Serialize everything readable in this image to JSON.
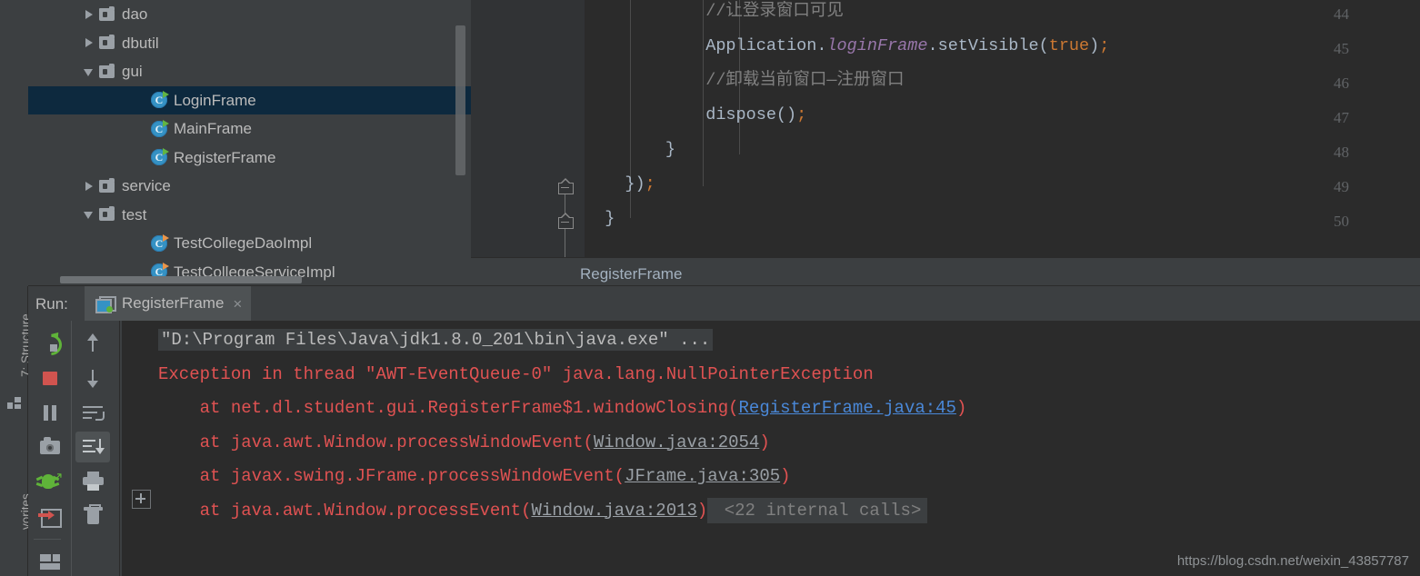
{
  "tool_strip": {
    "structure_tab": "7: Structure",
    "favorites_tab": "vorites"
  },
  "project_tree": {
    "items": [
      {
        "label": "dao",
        "kind": "folder",
        "arrow": "right",
        "indent": 60,
        "selected": false
      },
      {
        "label": "dbutil",
        "kind": "folder",
        "arrow": "right",
        "indent": 60,
        "selected": false
      },
      {
        "label": "gui",
        "kind": "folder",
        "arrow": "down",
        "indent": 60,
        "selected": false
      },
      {
        "label": "LoginFrame",
        "kind": "class",
        "arrow": "none",
        "indent": 135,
        "selected": true
      },
      {
        "label": "MainFrame",
        "kind": "class",
        "arrow": "none",
        "indent": 135,
        "selected": false
      },
      {
        "label": "RegisterFrame",
        "kind": "class",
        "arrow": "none",
        "indent": 135,
        "selected": false
      },
      {
        "label": "service",
        "kind": "folder",
        "arrow": "right",
        "indent": 60,
        "selected": false
      },
      {
        "label": "test",
        "kind": "folder",
        "arrow": "down",
        "indent": 60,
        "selected": false
      },
      {
        "label": "TestCollegeDaoImpl",
        "kind": "test-class",
        "arrow": "none",
        "indent": 135,
        "selected": false
      },
      {
        "label": "TestCollegeServiceImpl",
        "kind": "test-class",
        "arrow": "none",
        "indent": 135,
        "selected": false
      }
    ]
  },
  "editor": {
    "line_numbers": [
      "44",
      "45",
      "46",
      "47",
      "48",
      "49",
      "50"
    ],
    "lines": [
      {
        "num": "44",
        "segments": [
          {
            "text": "            //让登录窗口可见",
            "cls": "tok-cmt"
          }
        ]
      },
      {
        "num": "45",
        "segments": [
          {
            "text": "            Application",
            "cls": "tok-plain"
          },
          {
            "text": ".",
            "cls": "tok-plain"
          },
          {
            "text": "loginFrame",
            "cls": "tok-field"
          },
          {
            "text": ".setVisible(",
            "cls": "tok-plain"
          },
          {
            "text": "true",
            "cls": "tok-kw"
          },
          {
            "text": ")",
            "cls": "tok-plain"
          },
          {
            "text": ";",
            "cls": "tok-semi"
          }
        ]
      },
      {
        "num": "46",
        "segments": [
          {
            "text": "            //卸载当前窗口—注册窗口",
            "cls": "tok-cmt"
          }
        ]
      },
      {
        "num": "47",
        "segments": [
          {
            "text": "            dispose()",
            "cls": "tok-plain"
          },
          {
            "text": ";",
            "cls": "tok-semi"
          }
        ]
      },
      {
        "num": "48",
        "segments": [
          {
            "text": "        }",
            "cls": "tok-plain"
          }
        ]
      },
      {
        "num": "49",
        "segments": [
          {
            "text": "    })",
            "cls": "tok-plain"
          },
          {
            "text": ";",
            "cls": "tok-semi"
          }
        ]
      },
      {
        "num": "50",
        "segments": [
          {
            "text": "  }",
            "cls": "tok-plain"
          }
        ]
      }
    ]
  },
  "breadcrumb": {
    "text": "RegisterFrame"
  },
  "run_panel": {
    "label": "Run:",
    "tab_title": "RegisterFrame",
    "close_label": "×",
    "toolbar_left": [
      "rerun-icon",
      "stop-icon",
      "pause-icon",
      "camera-icon",
      "debug-icon",
      "export-icon",
      "layout-icon"
    ],
    "toolbar_right": [
      "arrow-up-icon",
      "arrow-down-icon",
      "soft-wrap-icon",
      "scroll-to-end-icon",
      "print-icon",
      "trash-icon"
    ]
  },
  "console": {
    "lines": [
      {
        "type": "command",
        "text": "\"D:\\Program Files\\Java\\jdk1.8.0_201\\bin\\java.exe\" ..."
      },
      {
        "type": "error",
        "text": "Exception in thread \"AWT-EventQueue-0\" java.lang.NullPointerException"
      },
      {
        "type": "trace",
        "prefix": "    at net.dl.student.gui.RegisterFrame$1.windowClosing(",
        "link": "RegisterFrame.java:45",
        "link_style": "clickable",
        "suffix": ")"
      },
      {
        "type": "trace",
        "prefix": "    at java.awt.Window.processWindowEvent(",
        "link": "Window.java:2054",
        "link_style": "library",
        "suffix": ")"
      },
      {
        "type": "trace",
        "prefix": "    at javax.swing.JFrame.processWindowEvent(",
        "link": "JFrame.java:305",
        "link_style": "library",
        "suffix": ")"
      },
      {
        "type": "trace-folded",
        "prefix": "    at java.awt.Window.processEvent(",
        "link": "Window.java:2013",
        "link_style": "library",
        "suffix": ")",
        "folded": "<22 internal calls>"
      }
    ]
  },
  "watermark": {
    "url": "https://blog.csdn.net/weixin_43857787"
  },
  "colors": {
    "editor_bg": "#2b2b2b",
    "panel_bg": "#3c3f41",
    "selection": "#0d293e",
    "error_red": "#e05252",
    "link_blue": "#4a88d8",
    "keyword_orange": "#cc7832",
    "field_purple": "#9876aa",
    "comment_grey": "#808080",
    "accent_green": "#5fb339"
  }
}
